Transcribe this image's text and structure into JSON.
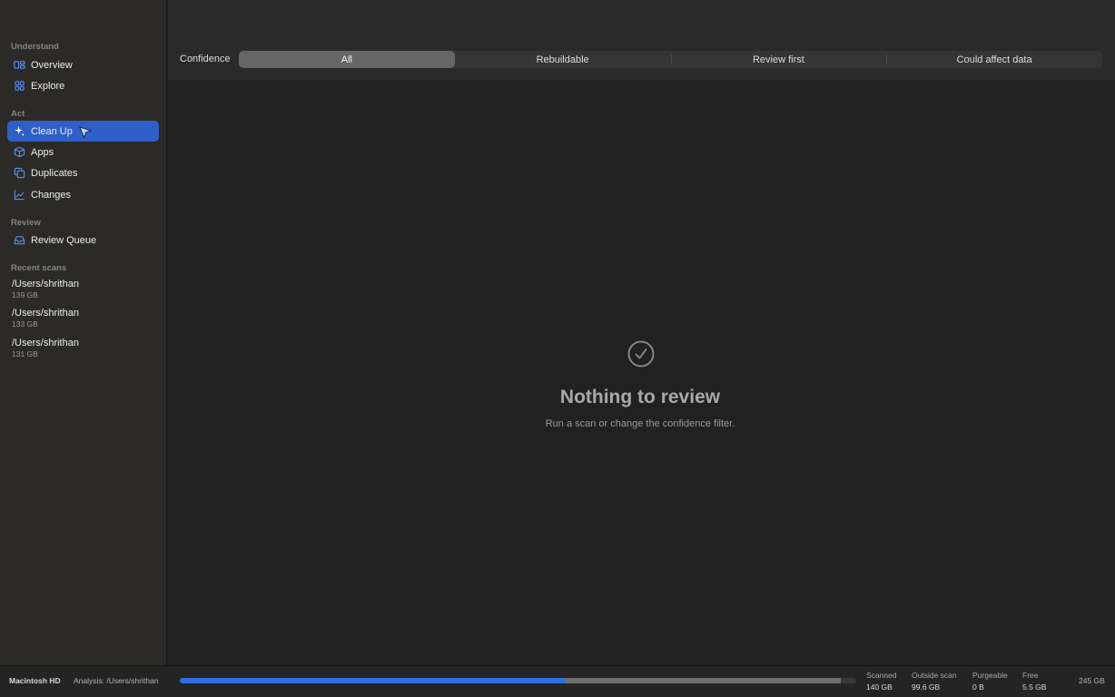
{
  "sidebar": {
    "sections": [
      {
        "label": "Understand"
      },
      {
        "label": "Act"
      },
      {
        "label": "Review"
      },
      {
        "label": "Recent scans"
      }
    ],
    "items": [
      {
        "label": "Overview",
        "icon": "overview-icon"
      },
      {
        "label": "Explore",
        "icon": "grid-icon"
      },
      {
        "label": "Clean Up",
        "icon": "sparkle-icon",
        "active": true
      },
      {
        "label": "Apps",
        "icon": "cube-icon"
      },
      {
        "label": "Duplicates",
        "icon": "duplicate-icon"
      },
      {
        "label": "Changes",
        "icon": "chart-line-icon"
      },
      {
        "label": "Review Queue",
        "icon": "tray-icon"
      }
    ],
    "recent_scans": [
      {
        "path": "/Users/shrithan",
        "size": "139 GB"
      },
      {
        "path": "/Users/shrithan",
        "size": "133 GB"
      },
      {
        "path": "/Users/shrithan",
        "size": "131 GB"
      }
    ]
  },
  "filter": {
    "label": "Confidence",
    "options": [
      "All",
      "Rebuildable",
      "Review first",
      "Could affect data"
    ],
    "selected": "All"
  },
  "empty_state": {
    "icon": "checkmark-circle-icon",
    "title": "Nothing to review",
    "subtitle": "Run a scan or change the confidence filter."
  },
  "status": {
    "disk": "Macintosh HD",
    "analysis": "Analysis: /Users/shrithan",
    "usage": {
      "scanned_fraction": 0.571,
      "outside_fraction": 0.406
    },
    "stats": [
      {
        "label": "Scanned",
        "value": "140 GB"
      },
      {
        "label": "Outside scan",
        "value": "99.6 GB"
      },
      {
        "label": "Purgeable",
        "value": "0 B"
      },
      {
        "label": "Free",
        "value": "5.5 GB"
      }
    ],
    "total": "245 GB"
  },
  "colors": {
    "accent": "#2f5fc8",
    "scanned_bar": "#2f6fe0",
    "outside_bar": "#6e6e6e"
  }
}
